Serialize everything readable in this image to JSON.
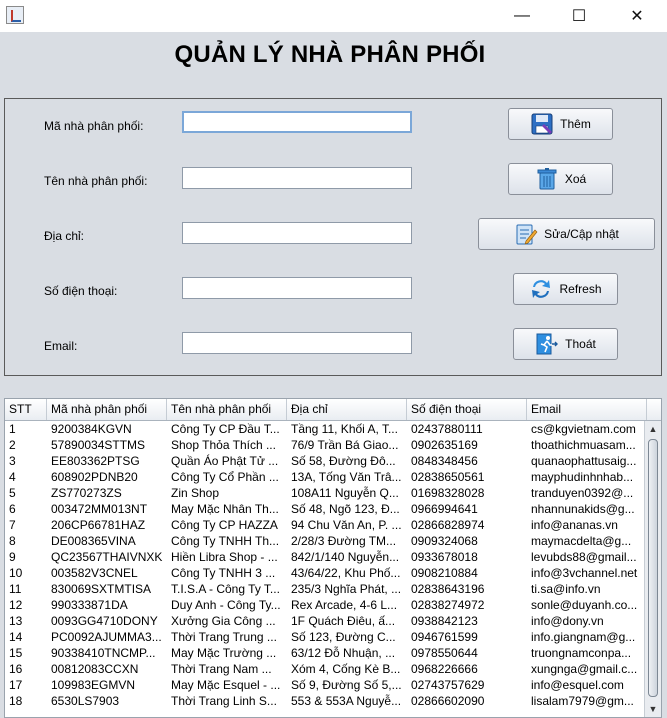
{
  "window": {
    "minimize": "—",
    "maximize": "☐",
    "close": "✕"
  },
  "title": "QUẢN LÝ NHÀ PHÂN PHỐI",
  "form": {
    "ma_label": "Mã nhà phân phối:",
    "ten_label": "Tên nhà phân phối:",
    "diachi_label": "Địa chỉ:",
    "sdt_label": "Số điện thoại:",
    "email_label": "Email:",
    "ma_value": "",
    "ten_value": "",
    "diachi_value": "",
    "sdt_value": "",
    "email_value": ""
  },
  "buttons": {
    "them": "Thêm",
    "xoa": "Xoá",
    "sua": "Sửa/Cập nhật",
    "refresh": "Refresh",
    "thoat": "Thoát"
  },
  "icons": {
    "them": "save-icon",
    "xoa": "trash-icon",
    "sua": "edit-icon",
    "refresh": "refresh-icon",
    "thoat": "exit-icon"
  },
  "colors": {
    "background": "#d9dde3",
    "table_header": "#e9edf2",
    "accent": "#2b7bd6"
  },
  "table": {
    "columns": [
      "STT",
      "Mã nhà phân phối",
      "Tên nhà phân phối",
      "Địa chỉ",
      "Số điện thoại",
      "Email"
    ],
    "rows": [
      [
        "1",
        "9200384KGVN",
        "Công Ty CP Đầu T...",
        "Tầng 11, Khối A, T...",
        "02437880111",
        "cs@kgvietnam.com"
      ],
      [
        "2",
        "57890034STTMS",
        "Shop Thỏa Thích ...",
        "76/9 Trần Bá Giao...",
        "0902635169",
        "thoathichmuasam..."
      ],
      [
        "3",
        "EE803362PTSG",
        "Quần Áo Phật Tử ...",
        "Số 58, Đường Đô...",
        "0848348456",
        "quanaophattusaig..."
      ],
      [
        "4",
        "608902PDNB20",
        "Công Ty Cổ Phần ...",
        "13A, Tống Văn Trâ...",
        "02838650561",
        "mayphudinhnhab..."
      ],
      [
        "5",
        "ZS770273ZS",
        "Zin Shop",
        "108A11 Nguyễn Q...",
        "01698328028",
        "tranduyen0392@..."
      ],
      [
        "6",
        "003472MM013NT",
        "May Mặc Nhân Th...",
        "Số 48, Ngõ 123, Đ...",
        "0966994641",
        "nhannunakids@g..."
      ],
      [
        "7",
        "206CP66781HAZ",
        "Công Ty CP HAZZA",
        "94 Chu Văn An, P. ...",
        "02866828974",
        "info@ananas.vn"
      ],
      [
        "8",
        "DE008365VINA",
        "Công Ty TNHH Th...",
        "2/28/3 Đường TM...",
        "0909324068",
        "maymacdelta@g..."
      ],
      [
        "9",
        "QC23567THAIVNXK",
        "Hiền Libra Shop - ...",
        "842/1/140 Nguyễn...",
        "0933678018",
        "levubds88@gmail..."
      ],
      [
        "10",
        "003582V3CNEL",
        "Công Ty TNHH 3 ...",
        "43/64/22, Khu Phố...",
        "0908210884",
        "info@3vchannel.net"
      ],
      [
        "11",
        "830069SXTMTISA",
        "T.I.S.A - Công Ty T...",
        "235/3 Nghĩa Phát, ...",
        "02838643196",
        "ti.sa@info.vn"
      ],
      [
        "12",
        "990333871DA",
        "Duy Anh - Công Ty...",
        "Rex Arcade, 4-6 L...",
        "02838274972",
        "sonle@duyanh.co..."
      ],
      [
        "13",
        "0093GG4710DONY",
        "Xưởng Gia Công ...",
        "1F Quách Điêu, ấ...",
        "0938842123",
        "info@dony.vn"
      ],
      [
        "14",
        "PC0092AJUMMA3...",
        "Thời Trang Trung ...",
        "Số 123, Đường C...",
        "0946761599",
        "info.giangnam@g..."
      ],
      [
        "15",
        "90338410TNCMP...",
        "May Mặc Trường ...",
        "63/12 Đỗ Nhuận, ...",
        "0978550644",
        "truongnamconpa..."
      ],
      [
        "16",
        "00812083CCXN",
        "Thời Trang Nam ...",
        "Xóm 4, Cống Kè B...",
        "0968226666",
        "xungnga@gmail.c..."
      ],
      [
        "17",
        "109983EGMVN",
        "May Mặc Esquel - ...",
        "Số 9, Đường Số 5,...",
        "02743757629",
        "info@esquel.com"
      ],
      [
        "18",
        "6530LS7903",
        "Thời Trang Linh S...",
        "553 & 553A Nguyễ...",
        "02866602090",
        "lisalam7979@gm..."
      ]
    ]
  }
}
